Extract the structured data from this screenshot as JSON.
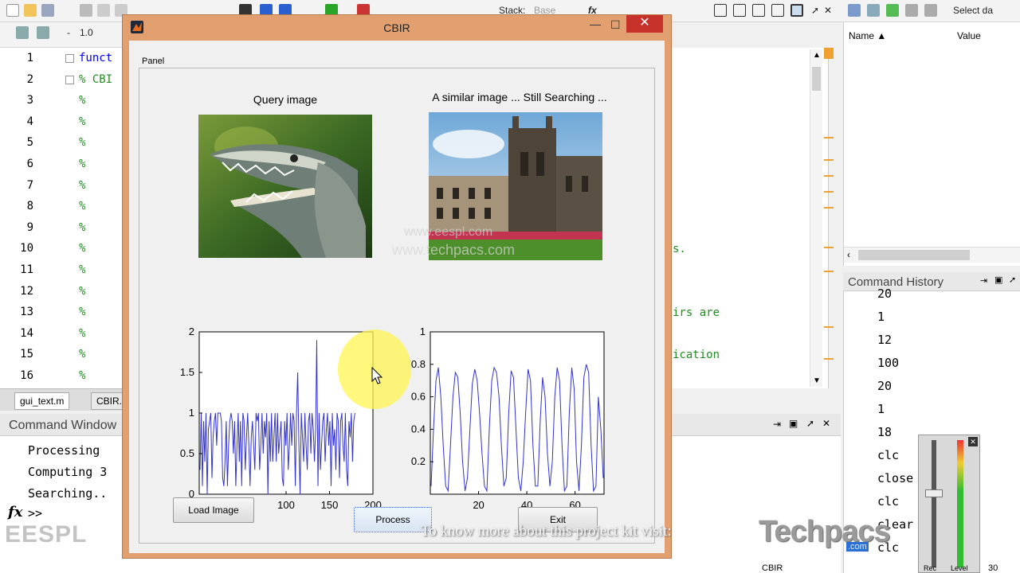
{
  "toolbar": {
    "stack_label": "Stack:",
    "stack_value": "Base",
    "fx": "fx",
    "zoom_value": "1.0",
    "minus": "-",
    "select_data": "Select da"
  },
  "editor": {
    "line_numbers": [
      "1",
      "2",
      "3",
      "4",
      "5",
      "6",
      "7",
      "8",
      "9",
      "10",
      "11",
      "12",
      "13",
      "14",
      "15",
      "16"
    ],
    "line1": "funct",
    "line2": "% CBI",
    "comment_mark": "%",
    "tail_line10": "s.",
    "tail_line13": "irs are",
    "tail_line15": "ication",
    "tabs": [
      "gui_text.m",
      "CBIR.r"
    ]
  },
  "command_window": {
    "title": "Command Window",
    "lines": [
      "Processing",
      "Computing 3",
      "Searching.."
    ],
    "prompt": ">>",
    "fx": "fx"
  },
  "workspace": {
    "col_name": "Name",
    "col_value": "Value"
  },
  "history": {
    "title": "Command History",
    "items": [
      "20",
      "1",
      "12",
      "100",
      "20",
      "1",
      "18",
      "clc",
      "close",
      "clc",
      "clear",
      "clc"
    ]
  },
  "status": {
    "cbir": "CBIR",
    "num": "30",
    "rec": "Rec",
    "level": "Level"
  },
  "cbir": {
    "title": "CBIR",
    "panel_label": "Panel",
    "query_title": "Query image",
    "result_title": "A similar image ... Still Searching ...",
    "buttons": {
      "load": "Load Image",
      "process": "Process",
      "exit": "Exit"
    },
    "watermark_1": "www.eespl.com",
    "watermark_2": "www.techpacs.com"
  },
  "footer": {
    "logo": "EESPL",
    "caption": "To know more about this project kit visit:",
    "brand": "Techpacs",
    "brand_sub": ".com"
  },
  "chart_data": [
    {
      "type": "line",
      "title": "",
      "xlabel": "",
      "ylabel": "",
      "xlim": [
        0,
        200
      ],
      "ylim": [
        0,
        2
      ],
      "yticks": [
        "0",
        "0.5",
        "1",
        "1.5",
        "2"
      ],
      "xticks": [
        "100",
        "150",
        "200"
      ],
      "grid": false,
      "color": "#3333cc",
      "series": [
        {
          "values": [
            0.3,
            1.0,
            0.1,
            0.9,
            0.4,
            1.0,
            0.0,
            0.8,
            0.9,
            1.0,
            0.2,
            0.7,
            0.9,
            1.0,
            0.6,
            1.0,
            1.0,
            1.0,
            0.9,
            0.2,
            0.1,
            0.4,
            0.9,
            0.1,
            0.6,
            0.9,
            1.0,
            0.9,
            0.5,
            0.9,
            0.1,
            0.6,
            1.0,
            0.4,
            0.9,
            0.1,
            1.0,
            0.9,
            0.3,
            0.7,
            1.0,
            0.6,
            0.1,
            0.7,
            0.9,
            0.6,
            0.3,
            1.0,
            0.9,
            1.0,
            0.3,
            0.6,
            1.0,
            0.5,
            0.9,
            0.7,
            1.0,
            0.0,
            0.9,
            0.4,
            1.0,
            0.4,
            0.7,
            1.0,
            0.4,
            1.0,
            0.5,
            0.7,
            0.9,
            0.2,
            0.1,
            0.9,
            0.6,
            1.0,
            0.3,
            0.6,
            1.0,
            0.6,
            1.0,
            0.9,
            0.1,
            1.0,
            1.5,
            0.6,
            0.0,
            1.0,
            0.7,
            0.4,
            1.0,
            0.6,
            0.3,
            0.9,
            1.0,
            0.5,
            1.0,
            0.8,
            0.4,
            0.8,
            1.9,
            0.1,
            1.0,
            0.3,
            0.6,
            0.9,
            1.0,
            0.4,
            0.8,
            1.0,
            0.6,
            0.9,
            0.1,
            1.0,
            0.6,
            0.8,
            0.3,
            1.0,
            0.9,
            0.2,
            0.9,
            1.0,
            0.6,
            0.4,
            1.0,
            0.3,
            0.1,
            0.9,
            0.7,
            1.0,
            0.4,
            0.9,
            1.0
          ]
        }
      ]
    },
    {
      "type": "line",
      "title": "",
      "xlabel": "",
      "ylabel": "",
      "xlim": [
        0,
        72
      ],
      "ylim": [
        0,
        1
      ],
      "yticks": [
        "0.2",
        "0.4",
        "0.6",
        "0.8",
        "1"
      ],
      "xticks": [
        "20",
        "40",
        "60"
      ],
      "grid": false,
      "color": "#3333cc",
      "series": [
        {
          "values": [
            0.05,
            0.4,
            0.7,
            0.78,
            0.6,
            0.3,
            0.05,
            0.02,
            0.3,
            0.6,
            0.75,
            0.72,
            0.5,
            0.2,
            0.02,
            0.1,
            0.4,
            0.68,
            0.77,
            0.7,
            0.5,
            0.25,
            0.05,
            0.02,
            0.4,
            0.7,
            0.78,
            0.75,
            0.6,
            0.3,
            0.05,
            0.1,
            0.5,
            0.76,
            0.72,
            0.4,
            0.1,
            0.02,
            0.2,
            0.5,
            0.77,
            0.7,
            0.3,
            0.05,
            0.05,
            0.45,
            0.72,
            0.6,
            0.25,
            0.05,
            0.2,
            0.6,
            0.78,
            0.7,
            0.3,
            0.02,
            0.05,
            0.5,
            0.78,
            0.65,
            0.2,
            0.02,
            0.3,
            0.72,
            0.8,
            0.75,
            0.3,
            0.02,
            0.05,
            0.6,
            0.4,
            0.1
          ]
        }
      ]
    }
  ]
}
